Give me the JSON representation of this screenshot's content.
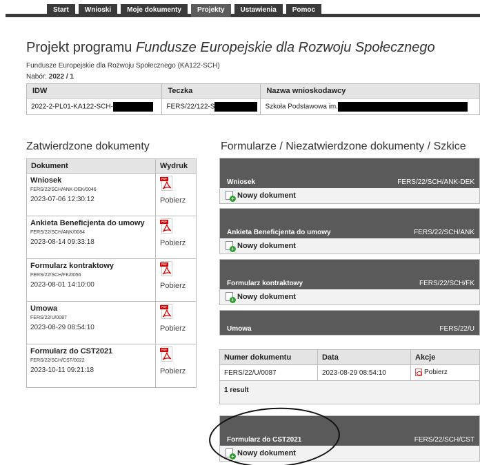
{
  "nav": {
    "tabs": [
      {
        "label": "Start",
        "active": false
      },
      {
        "label": "Wnioski",
        "active": false
      },
      {
        "label": "Moje dokumenty",
        "active": false
      },
      {
        "label": "Projekty",
        "active": true
      },
      {
        "label": "Ustawienia",
        "active": false
      },
      {
        "label": "Pomoc",
        "active": false
      }
    ]
  },
  "project": {
    "title_prefix": "Projekt programu",
    "title_italic": "Fundusze Europejskie dla Rozwoju Społecznego",
    "subtitle": "Fundusze Europejskie dla Rozwoju Społecznego (KA122-SCH)",
    "nabor_label": "Nabór:",
    "nabor_value": "2022 / 1",
    "info_table": {
      "headers": [
        "IDW",
        "Teczka",
        "Nazwa wnioskodawcy"
      ],
      "row": [
        "2022-2-PL01-KA122-SCH-",
        "FERS/22/122-S",
        "Szkoła Podstawowa im."
      ]
    }
  },
  "approved": {
    "heading": "Zatwierdzone dokumenty",
    "headers": [
      "Dokument",
      "Wydruk"
    ],
    "pdf_badge": "PDF",
    "items": [
      {
        "name": "Wniosek",
        "code": "FERS/22/SCH/ANK-DEK/0046",
        "date": "2023-07-06 12:30:12",
        "action": "Pobierz"
      },
      {
        "name": "Ankieta Beneficjenta do umowy",
        "code": "FERS/22/SCH/ANK/0084",
        "date": "2023-08-14 09:33:18",
        "action": "Pobierz"
      },
      {
        "name": "Formularz kontraktowy",
        "code": "FERS/22/SCH/FK/0056",
        "date": "2023-08-01 14:10:00",
        "action": "Pobierz"
      },
      {
        "name": "Umowa",
        "code": "FERS/22/U/0087",
        "date": "2023-08-29 08:54:10",
        "action": "Pobierz"
      },
      {
        "name": "Formularz do CST2021",
        "code": "FERS/22/SCH/CST/0022",
        "date": "2023-10-11 09:21:18",
        "action": "Pobierz"
      }
    ]
  },
  "forms": {
    "heading": "Formularze / Niezatwierdzone dokumenty / Szkice",
    "new_label": "Nowy dokument",
    "panels": [
      {
        "title": "Wniosek",
        "code": "FERS/22/SCH/ANK-DEK"
      },
      {
        "title": "Ankieta Beneficjenta do umowy",
        "code": "FERS/22/SCH/ANK"
      },
      {
        "title": "Formularz kontraktowy",
        "code": "FERS/22/SCH/FK"
      },
      {
        "title": "Umowa",
        "code": "FERS/22/U"
      },
      {
        "title": "Formularz do CST2021",
        "code": "FERS/22/SCH/CST"
      }
    ],
    "umowa_table": {
      "headers": [
        "Numer dokumentu",
        "Data",
        "Akcje"
      ],
      "row": [
        "FERS/22/U/0087",
        "2023-08-29 08:54:10",
        "Pobierz"
      ],
      "result": "1 result"
    }
  }
}
